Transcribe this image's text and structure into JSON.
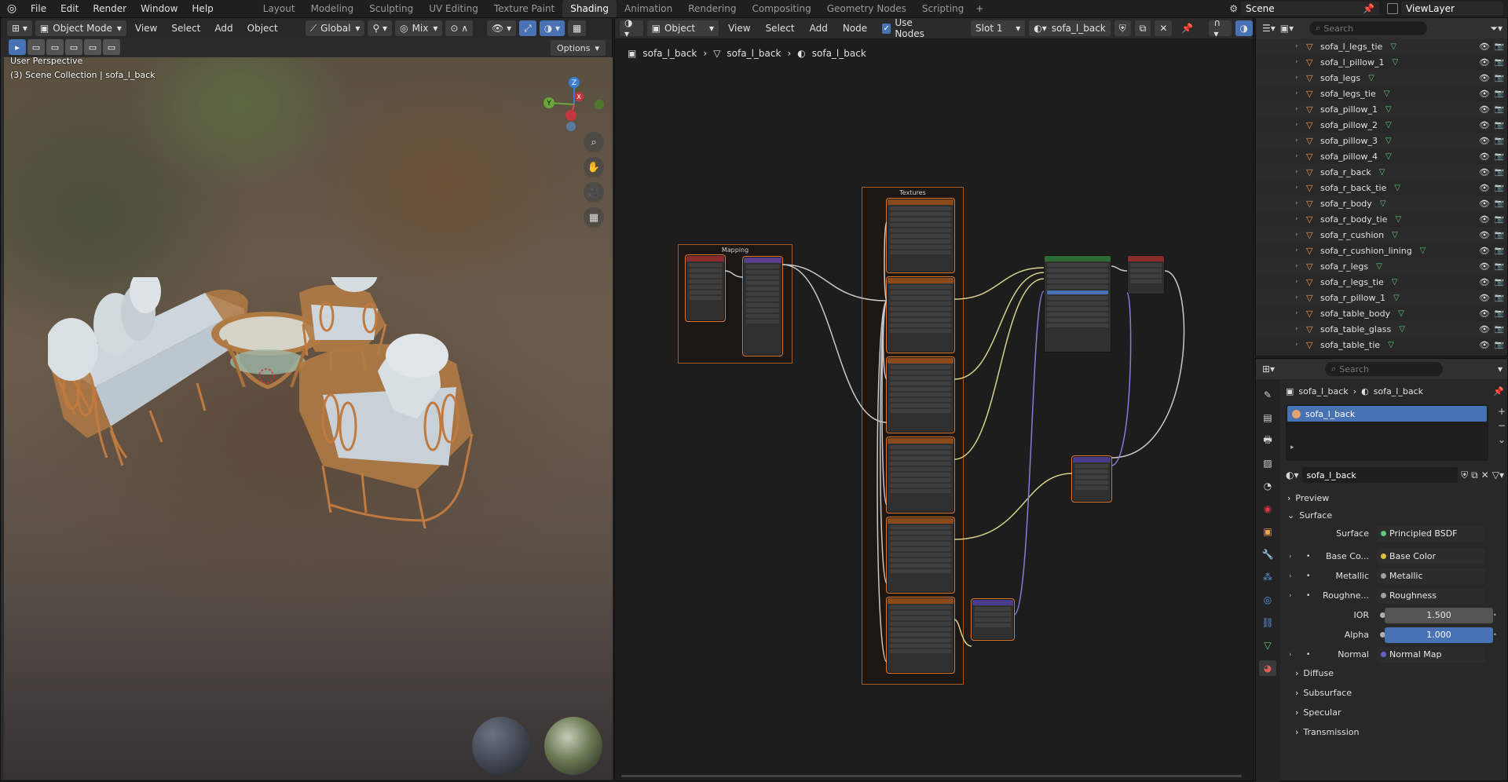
{
  "topbar": {
    "menus": [
      "File",
      "Edit",
      "Render",
      "Window",
      "Help"
    ],
    "workspaces": [
      "Layout",
      "Modeling",
      "Sculpting",
      "UV Editing",
      "Texture Paint",
      "Shading",
      "Animation",
      "Rendering",
      "Compositing",
      "Geometry Nodes",
      "Scripting"
    ],
    "active_workspace": "Shading",
    "scene": "Scene",
    "view_layer": "ViewLayer"
  },
  "viewport": {
    "mode": "Object Mode",
    "menus": [
      "View",
      "Select",
      "Add",
      "Object"
    ],
    "orientation": "Global",
    "snap": "Mix",
    "options": "Options",
    "info_line1": "User Perspective",
    "info_line2": "(3) Scene Collection | sofa_l_back",
    "axis_x": "X",
    "axis_y": "Y",
    "axis_z": "Z"
  },
  "node_editor": {
    "type": "Object",
    "menus": [
      "View",
      "Select",
      "Add",
      "Node"
    ],
    "use_nodes_label": "Use Nodes",
    "slot": "Slot 1",
    "material": "sofa_l_back",
    "breadcrumb": [
      "sofa_l_back",
      "sofa_l_back",
      "sofa_l_back"
    ],
    "frame_textures": "Textures",
    "frame_mapping": "Mapping"
  },
  "outliner": {
    "search_placeholder": "Search",
    "items": [
      "sofa_l_legs_tie",
      "sofa_l_pillow_1",
      "sofa_legs",
      "sofa_legs_tie",
      "sofa_pillow_1",
      "sofa_pillow_2",
      "sofa_pillow_3",
      "sofa_pillow_4",
      "sofa_r_back",
      "sofa_r_back_tie",
      "sofa_r_body",
      "sofa_r_body_tie",
      "sofa_r_cushion",
      "sofa_r_cushion_lining",
      "sofa_r_legs",
      "sofa_r_legs_tie",
      "sofa_r_pillow_1",
      "sofa_table_body",
      "sofa_table_glass",
      "sofa_table_tie"
    ]
  },
  "properties": {
    "search_placeholder": "Search",
    "breadcrumb_object": "sofa_l_back",
    "breadcrumb_material": "sofa_l_back",
    "slot_name": "sofa_l_back",
    "material_name": "sofa_l_back",
    "panel_preview": "Preview",
    "panel_surface": "Surface",
    "surface_label": "Surface",
    "surface_value": "Principled BSDF",
    "rows": [
      {
        "label": "Base Co...",
        "value": "Base Color"
      },
      {
        "label": "Metallic",
        "value": "Metallic"
      },
      {
        "label": "Roughne...",
        "value": "Roughness"
      }
    ],
    "ior_label": "IOR",
    "ior_value": "1.500",
    "alpha_label": "Alpha",
    "alpha_value": "1.000",
    "normal_label": "Normal",
    "normal_value": "Normal Map",
    "sub_panels": [
      "Diffuse",
      "Subsurface",
      "Specular",
      "Transmission"
    ]
  },
  "colors": {
    "accent_blue": "#4772b3",
    "frame_orange": "#a85a23",
    "object_icon": "#e8a05a",
    "material_icon": "#62c77a"
  }
}
